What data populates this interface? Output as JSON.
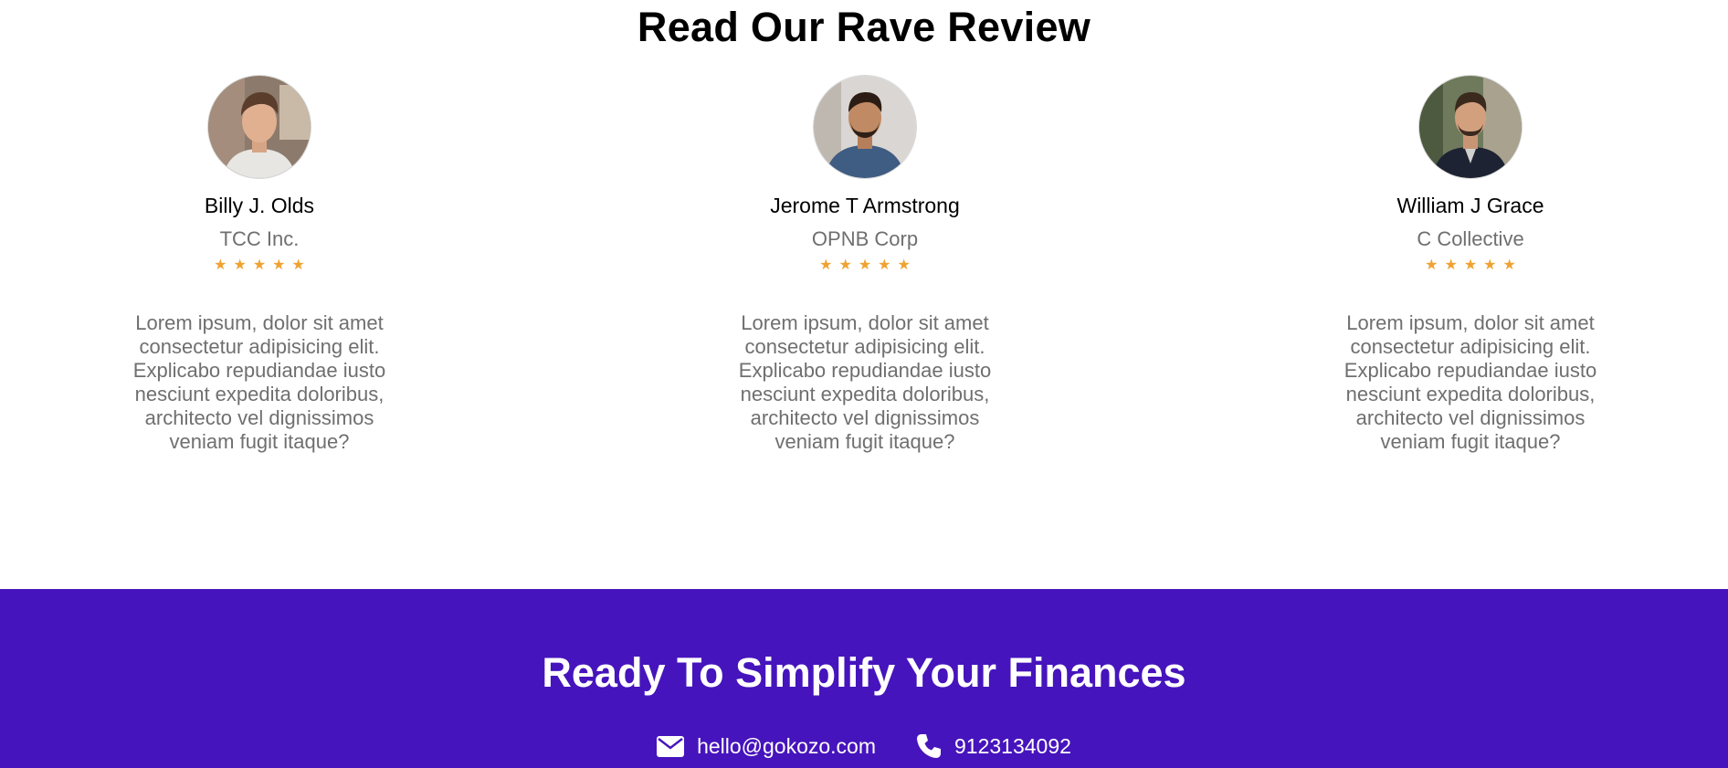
{
  "reviews": {
    "title": "Read Our Rave Review",
    "items": [
      {
        "name": "Billy J. Olds",
        "company": "TCC Inc.",
        "rating": 5,
        "stars": "★★★★★",
        "text": "Lorem ipsum, dolor sit amet consectetur adipisicing elit. Explicabo repudiandae iusto nesciunt expedita doloribus, architecto vel dignissimos veniam fugit itaque?"
      },
      {
        "name": "Jerome T Armstrong",
        "company": "OPNB Corp",
        "rating": 5,
        "stars": "★★★★★",
        "text": "Lorem ipsum, dolor sit amet consectetur adipisicing elit. Explicabo repudiandae iusto nesciunt expedita doloribus, architecto vel dignissimos veniam fugit itaque?"
      },
      {
        "name": "William J Grace",
        "company": "C Collective",
        "rating": 5,
        "stars": "★★★★★",
        "text": "Lorem ipsum, dolor sit amet consectetur adipisicing elit. Explicabo repudiandae iusto nesciunt expedita doloribus, architecto vel dignissimos veniam fugit itaque?"
      }
    ]
  },
  "cta": {
    "title": "Ready To Simplify Your Finances",
    "email": "hello@gokozo.com",
    "phone": "9123134092",
    "email_icon": "envelope-icon",
    "phone_icon": "phone-icon"
  },
  "colors": {
    "cta_background": "#4614bc",
    "star": "#f0a231",
    "muted_text": "#6f6f6f"
  }
}
